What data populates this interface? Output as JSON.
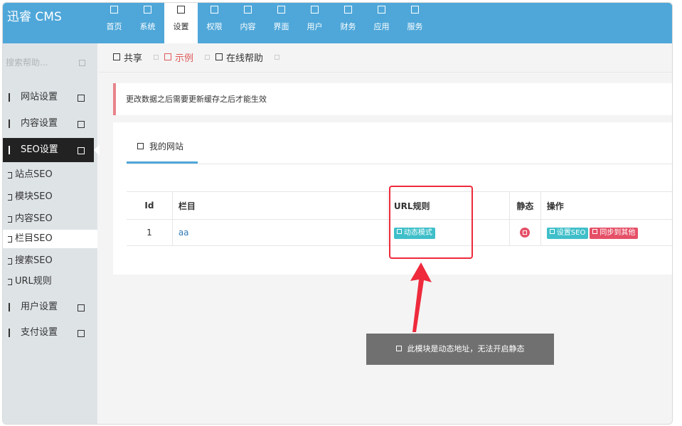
{
  "app": {
    "logo": "迅睿 CMS"
  },
  "nav": [
    {
      "label": "首页",
      "active": false
    },
    {
      "label": "系统",
      "active": false
    },
    {
      "label": "设置",
      "active": true
    },
    {
      "label": "权限",
      "active": false
    },
    {
      "label": "内容",
      "active": false
    },
    {
      "label": "界面",
      "active": false
    },
    {
      "label": "用户",
      "active": false
    },
    {
      "label": "财务",
      "active": false
    },
    {
      "label": "应用",
      "active": false
    },
    {
      "label": "服务",
      "active": false
    }
  ],
  "sidebar": {
    "search_placeholder": "搜索帮助...",
    "items": [
      {
        "label": "网站设置"
      },
      {
        "label": "内容设置"
      },
      {
        "label": "SEO设置"
      }
    ],
    "sub_items": [
      {
        "label": "站点SEO"
      },
      {
        "label": "模块SEO"
      },
      {
        "label": "内容SEO"
      },
      {
        "label": "栏目SEO"
      },
      {
        "label": "搜索SEO"
      },
      {
        "label": "URL规则"
      }
    ],
    "items_after": [
      {
        "label": "用户设置"
      },
      {
        "label": "支付设置"
      }
    ]
  },
  "breadcrumb": {
    "share": "共享",
    "example": "示例",
    "help": "在线帮助"
  },
  "notice": "更改数据之后需要更新缓存之后才能生效",
  "tab": {
    "label": "我的网站"
  },
  "table": {
    "headers": {
      "id": "Id",
      "column": "栏目",
      "url": "URL规则",
      "static": "静态",
      "ops": "操作"
    },
    "rows": [
      {
        "id": "1",
        "column": "aa",
        "url_badge": "动态模式",
        "op_seo": "设置SEO",
        "op_sync": "同步到其他"
      }
    ]
  },
  "tooltip": "此模块是动态地址，无法开启静态",
  "colors": {
    "primary": "#4fa7d9",
    "highlight": "#ee2a3c",
    "badge_blue": "#3fbfc9",
    "badge_red": "#e55067"
  }
}
